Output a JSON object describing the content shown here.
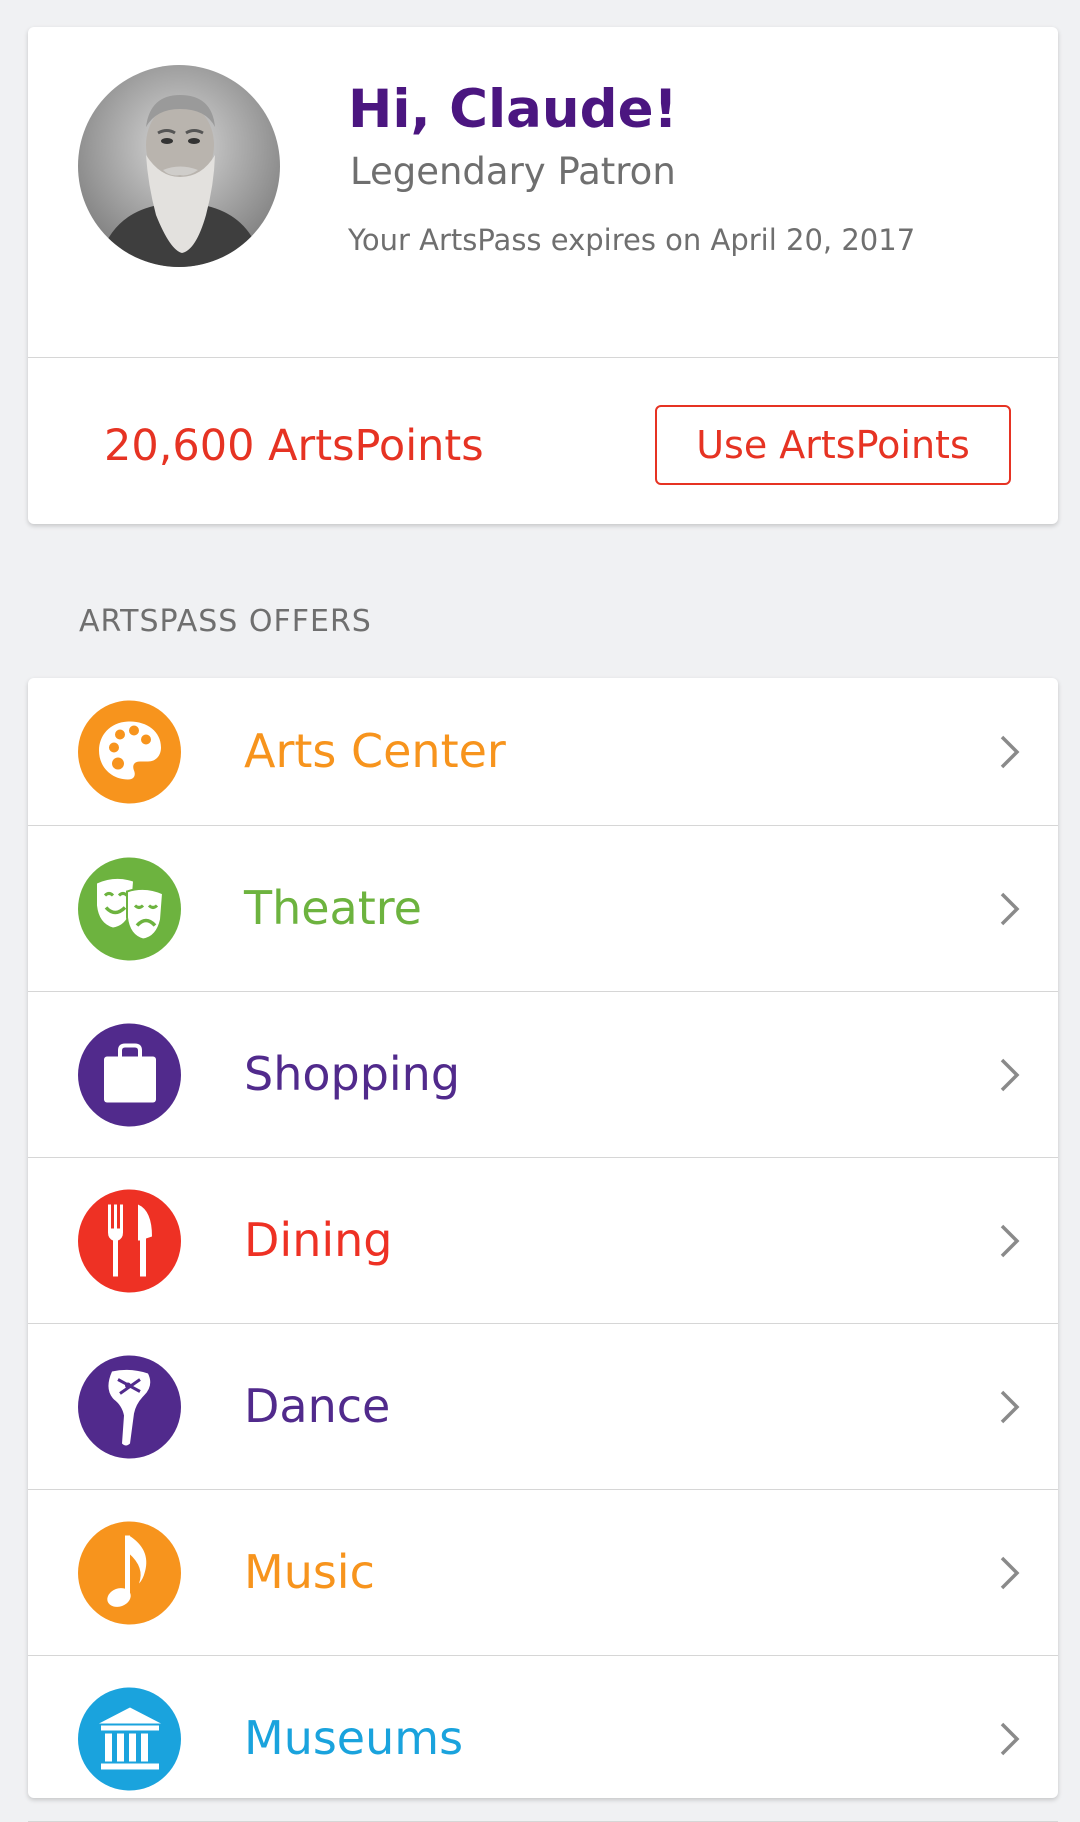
{
  "profile": {
    "greeting": "Hi, Claude!",
    "level": "Legendary Patron",
    "expiry": "Your ArtsPass expires on April 20, 2017",
    "points": "20,600 ArtsPoints",
    "use_points_label": "Use ArtsPoints"
  },
  "offers_header": "ARTSPASS OFFERS",
  "offers": [
    {
      "label": "Arts Center",
      "color": "#f7941d",
      "icon": "palette-icon"
    },
    {
      "label": "Theatre",
      "color": "#6db33f",
      "icon": "theatre-masks-icon"
    },
    {
      "label": "Shopping",
      "color": "#512a8c",
      "icon": "shopping-bag-icon"
    },
    {
      "label": "Dining",
      "color": "#ee3124",
      "icon": "fork-knife-icon"
    },
    {
      "label": "Dance",
      "color": "#512a8c",
      "icon": "ballet-shoe-icon"
    },
    {
      "label": "Music",
      "color": "#f7941d",
      "icon": "music-note-icon"
    },
    {
      "label": "Museums",
      "color": "#1aa3dd",
      "icon": "museum-icon"
    }
  ],
  "colors": {
    "greeting": "#4b1680",
    "points": "#e63323",
    "muted_text": "#6f6f6f",
    "background": "#f0f1f3"
  }
}
